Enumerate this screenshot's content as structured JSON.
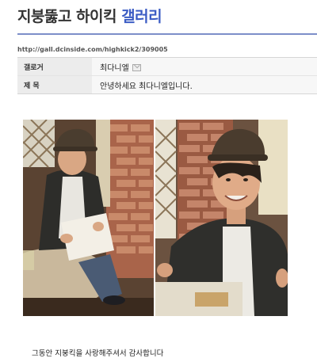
{
  "header": {
    "title_part1": "지붕뚫고 하이킥",
    "title_part2": "갤러리"
  },
  "url": "http://gall.dcinside.com/highkick2/309005",
  "meta": {
    "author_label": "갤로거",
    "author_value": "최다니엘",
    "subject_label": "제 목",
    "subject_value": "안녕하세요 최다니엘입니다."
  },
  "body_text": "그동안 지붕킥을 사랑해주셔서 감사합니다",
  "colors": {
    "title_accent": "#3b5cc4",
    "rule": "#7d8fc9"
  }
}
